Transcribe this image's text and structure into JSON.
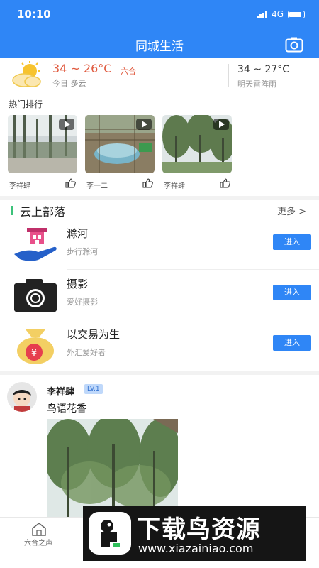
{
  "status_bar": {
    "time": "10:10",
    "network": "4G"
  },
  "header": {
    "title": "同城生活"
  },
  "weather": {
    "today_temp": "34 ~ 26°C",
    "location": "六合",
    "today_desc": "今日 多云",
    "tomorrow_temp": "34 ~ 27°C",
    "tomorrow_desc": "明天雷阵雨"
  },
  "hot": {
    "title": "热门排行",
    "videos": [
      {
        "author": "李祥肆"
      },
      {
        "author": "李一二"
      },
      {
        "author": "李祥肆"
      }
    ]
  },
  "tribes": {
    "title": "云上部落",
    "more": "更多 >",
    "items": [
      {
        "name": "滁河",
        "desc": "步行滁河",
        "button": "进入",
        "icon": "hand-house-icon"
      },
      {
        "name": "摄影",
        "desc": "爱好摄影",
        "button": "进入",
        "icon": "camera-icon"
      },
      {
        "name": "以交易为生",
        "desc": "外汇爱好者",
        "button": "进入",
        "icon": "money-bag-icon"
      }
    ]
  },
  "post": {
    "user": "李祥肆",
    "level": "LV.1",
    "text": "鸟语花香"
  },
  "tabbar": {
    "tabs": [
      {
        "label": "六合之声",
        "icon": "home-icon"
      }
    ]
  },
  "watermark": {
    "title": "下载鸟资源",
    "url": "www.xiazainiao.com"
  },
  "colors": {
    "brand": "#2f86f6",
    "temp": "#e05a3f",
    "accent_bar": "#3cc27a"
  }
}
